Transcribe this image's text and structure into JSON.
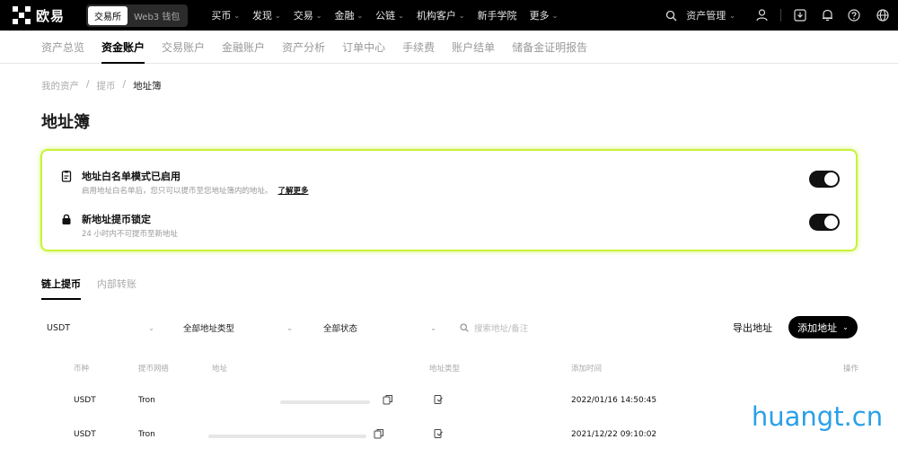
{
  "header": {
    "logo_text": "欧易",
    "mode_tabs": [
      "交易所",
      "Web3 钱包"
    ],
    "nav": [
      {
        "label": "买币",
        "has_caret": true
      },
      {
        "label": "发现",
        "has_caret": true
      },
      {
        "label": "交易",
        "has_caret": true
      },
      {
        "label": "金融",
        "has_caret": true
      },
      {
        "label": "公链",
        "has_caret": true
      },
      {
        "label": "机构客户",
        "has_caret": true
      },
      {
        "label": "新手学院",
        "has_caret": false
      },
      {
        "label": "更多",
        "has_caret": true
      }
    ],
    "asset_menu": "资产管理"
  },
  "subnav": {
    "items": [
      "资产总览",
      "资金账户",
      "交易账户",
      "金融账户",
      "资产分析",
      "订单中心",
      "手续费",
      "账户结单",
      "储备金证明报告"
    ],
    "active_index": 1
  },
  "breadcrumb": [
    "我的资产",
    "提币",
    "地址簿"
  ],
  "page_title": "地址簿",
  "settings": [
    {
      "icon": "clipboard-icon",
      "title": "地址白名单模式已启用",
      "desc": "启用地址白名单后，您只可以提币至您地址簿内的地址。",
      "link": "了解更多",
      "enabled": true
    },
    {
      "icon": "lock-icon",
      "title": "新地址提币锁定",
      "desc": "24 小时内不可提币至新地址",
      "enabled": true
    }
  ],
  "tabs": [
    "链上提币",
    "内部转账"
  ],
  "active_tab": 0,
  "filters": {
    "coin": "USDT",
    "address_type": "全部地址类型",
    "status": "全部状态",
    "search_placeholder": "搜索地址/备注"
  },
  "actions": {
    "export": "导出地址",
    "add": "添加地址"
  },
  "table": {
    "columns": [
      "币种",
      "提币网络",
      "地址",
      "地址类型",
      "添加时间",
      "操作"
    ],
    "rows": [
      {
        "coin": "USDT",
        "network": "Tron",
        "added": "2022/01/16 14:50:45"
      },
      {
        "coin": "USDT",
        "network": "Tron",
        "added": "2021/12/22 09:10:02"
      }
    ]
  },
  "watermark": "huangt.cn"
}
